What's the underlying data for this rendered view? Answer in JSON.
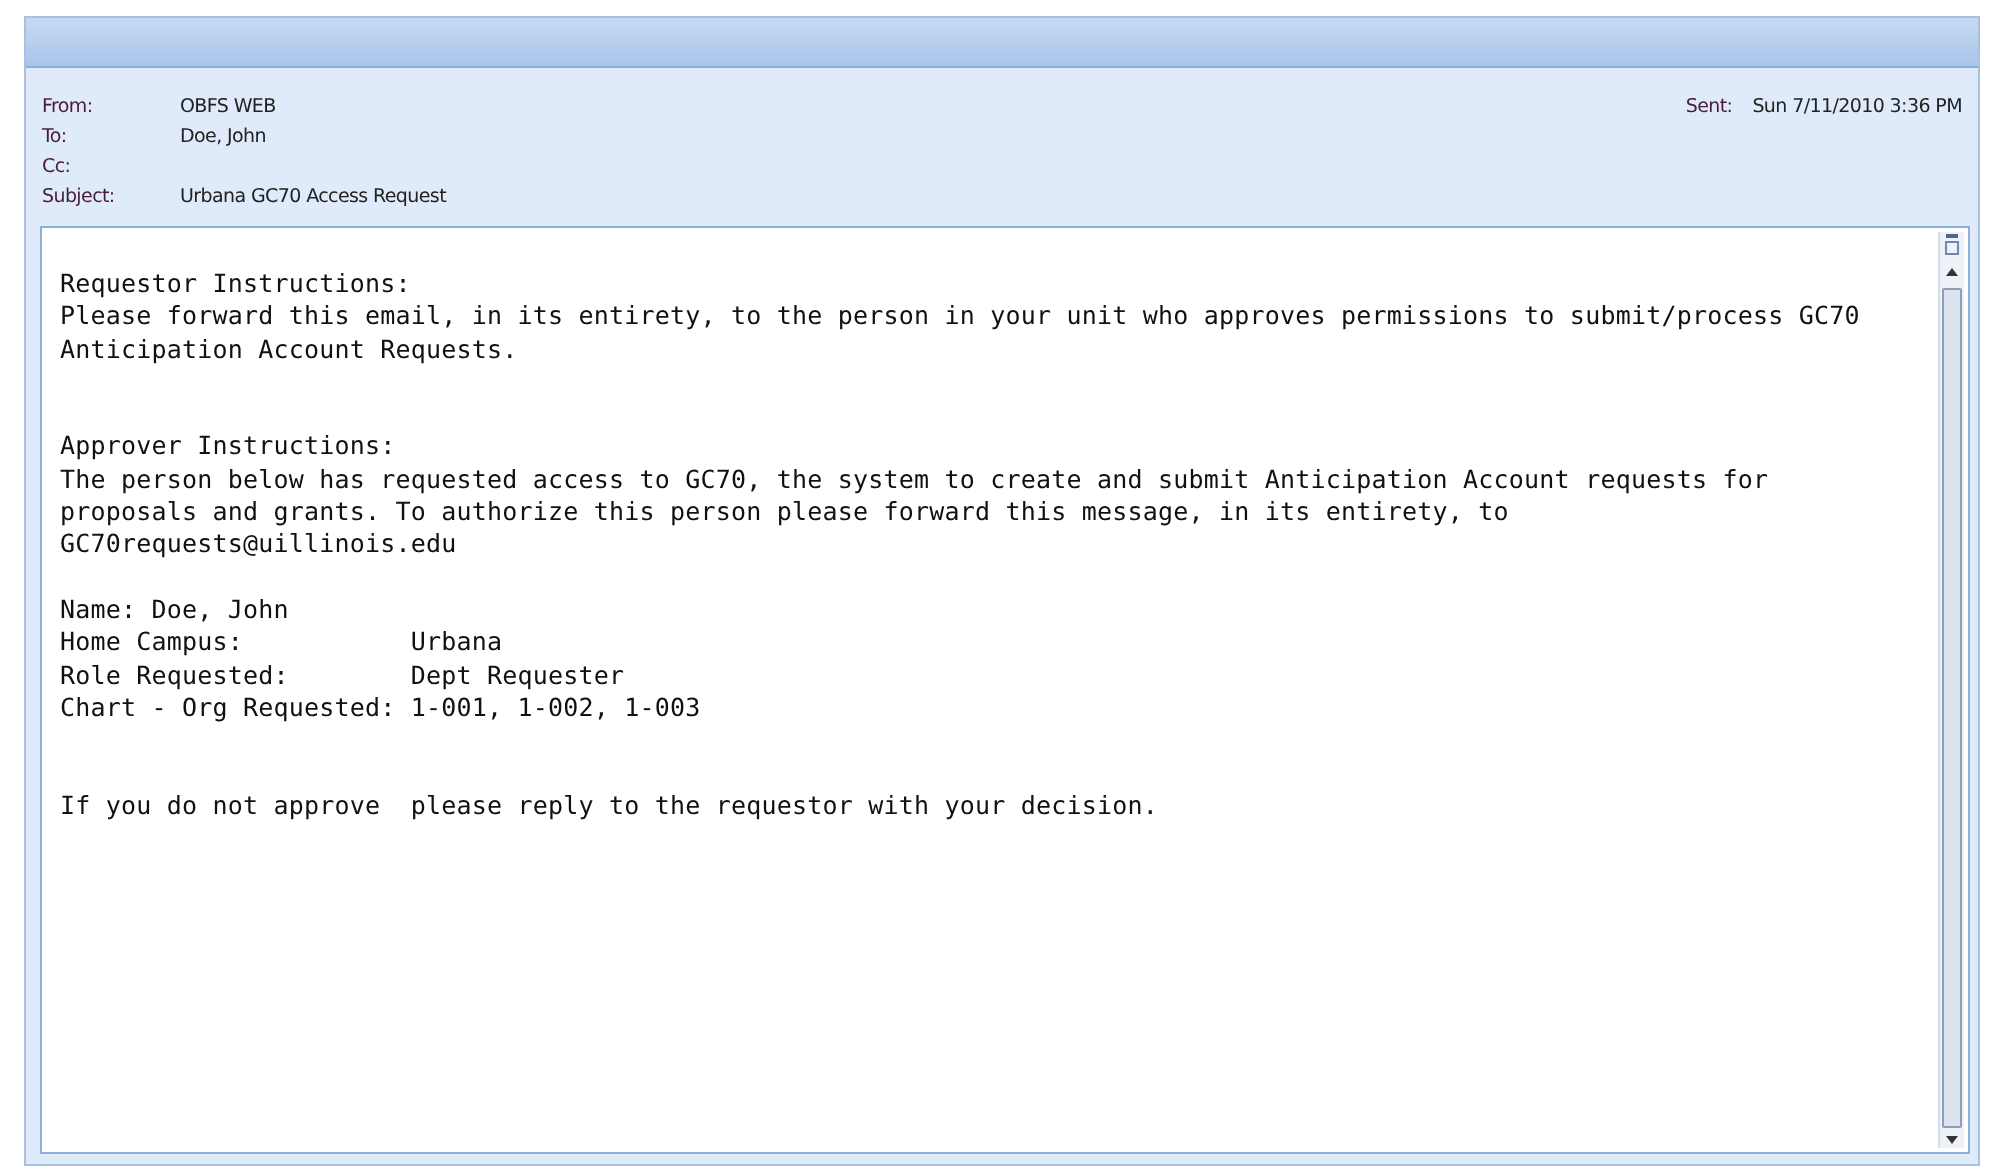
{
  "header": {
    "fields": [
      {
        "label": "From:",
        "value": "OBFS WEB"
      },
      {
        "label": "To:",
        "value": "Doe, John"
      },
      {
        "label": "Cc:"
      },
      {
        "label": "Subject:",
        "value": "Urbana GC70 Access Request"
      }
    ],
    "sent": {
      "label": "Sent:",
      "value": "Sun 7/11/2010 3:36 PM"
    }
  },
  "body": "Requestor Instructions:\nPlease forward this email, in its entirety, to the person in your unit who approves permissions to submit/process GC70\nAnticipation Account Requests.\n\n\nApprover Instructions:\nThe person below has requested access to GC70, the system to create and submit Anticipation Account requests for\nproposals and grants. To authorize this person please forward this message, in its entirety, to\nGC70requests@uillinois.edu\n\nName: Doe, John\nHome Campus:           Urbana\nRole Requested:        Dept Requester\nChart - Org Requested: 1-001, 1-002, 1-003\n\n\nIf you do not approve  please reply to the requestor with your decision."
}
